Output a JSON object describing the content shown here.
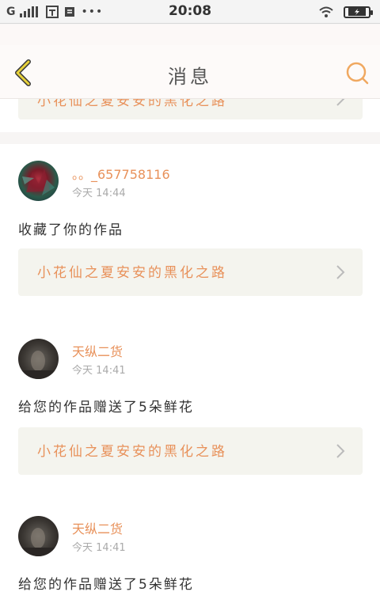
{
  "status_bar": {
    "carrier": "G",
    "time": "20:08",
    "dots": "•••"
  },
  "nav": {
    "title": "消息"
  },
  "top_card": {
    "work_title": "小花仙之夏安安的黑化之路"
  },
  "messages": [
    {
      "user": "。。_657758116",
      "date": "今天",
      "time": "14:44",
      "text": "收藏了你的作品",
      "work_title": "小花仙之夏安安的黑化之路"
    },
    {
      "user": "天纵二货",
      "date": "今天",
      "time": "14:41",
      "text": "给您的作品赠送了5朵鲜花",
      "work_title": "小花仙之夏安安的黑化之路"
    },
    {
      "user": "天纵二货",
      "date": "今天",
      "time": "14:41",
      "text": "给您的作品赠送了5朵鲜花"
    }
  ],
  "colors": {
    "accent": "#e8915a",
    "nav_icon": "#f0a860",
    "back_icon": "#e8d23a"
  }
}
